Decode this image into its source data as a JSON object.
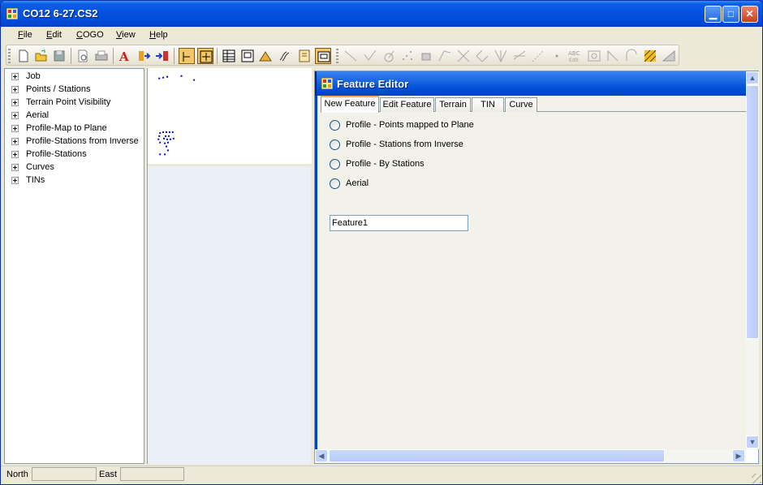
{
  "window": {
    "title": "CO12 6-27.CS2"
  },
  "menubar": {
    "items": [
      {
        "label": "File",
        "mnemonic": "F"
      },
      {
        "label": "Edit",
        "mnemonic": "E"
      },
      {
        "label": "COGO",
        "mnemonic": "C"
      },
      {
        "label": "View",
        "mnemonic": "V"
      },
      {
        "label": "Help",
        "mnemonic": "H"
      }
    ]
  },
  "toolbar": {
    "icons": [
      "new-icon",
      "open-icon",
      "save-icon",
      "print-preview-icon",
      "print-icon",
      "text-style-icon",
      "import-icon",
      "export-icon",
      "select-icon",
      "zoom-extents-icon",
      "grid-icon",
      "window-icon",
      "terrain-icon",
      "contour-icon",
      "properties-icon",
      "feature-editor-icon",
      "line-icon",
      "angle-icon",
      "circle-icon",
      "points-icon",
      "block-icon",
      "polyline-icon",
      "intersect-icon",
      "perpendicular-icon",
      "bisect-icon",
      "offset-icon",
      "measure-icon",
      "dot-icon",
      "abc-edit-icon",
      "image-icon",
      "traverse-icon",
      "area-icon",
      "hatch-icon",
      "slope-icon"
    ],
    "abc_label": "ABC",
    "edit_label": "Edit"
  },
  "tree": {
    "items": [
      {
        "label": "Job"
      },
      {
        "label": "Points / Stations"
      },
      {
        "label": "Terrain Point Visibility"
      },
      {
        "label": "Aerial"
      },
      {
        "label": "Profile-Map to Plane"
      },
      {
        "label": "Profile-Stations from Inverse"
      },
      {
        "label": "Profile-Stations"
      },
      {
        "label": "Curves"
      },
      {
        "label": "TINs"
      }
    ]
  },
  "feature_editor": {
    "title": "Feature Editor",
    "tabs": [
      {
        "label": "New Feature",
        "active": true
      },
      {
        "label": "Edit Feature",
        "active": false
      },
      {
        "label": "Terrain",
        "active": false
      },
      {
        "label": "TIN",
        "active": false
      },
      {
        "label": "Curve",
        "active": false
      }
    ],
    "options": [
      {
        "label": "Profile - Points mapped to Plane",
        "checked": false
      },
      {
        "label": "Profile - Stations from Inverse",
        "checked": false
      },
      {
        "label": "Profile - By Stations",
        "checked": false
      },
      {
        "label": "Aerial",
        "checked": false
      }
    ],
    "feature_name": "Feature1"
  },
  "statusbar": {
    "north_label": "North",
    "north_value": "",
    "east_label": "East",
    "east_value": ""
  },
  "colors": {
    "title_blue": "#0552e0",
    "point_blue": "#0000c8",
    "tab_highlight": "#f8b048"
  }
}
